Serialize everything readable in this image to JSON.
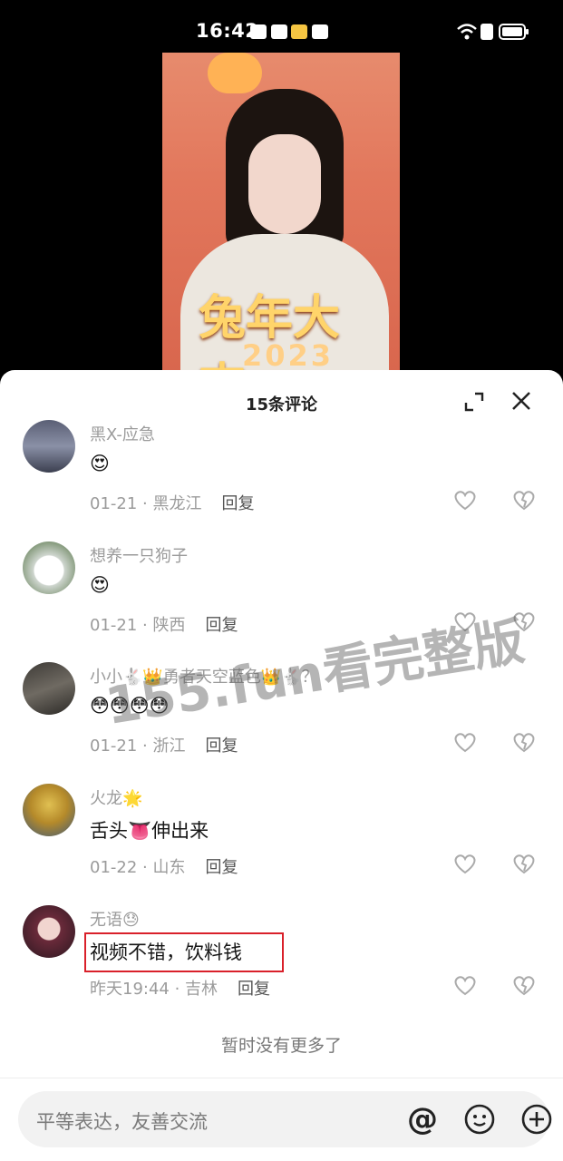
{
  "status_bar": {
    "time": "16:42"
  },
  "video": {
    "headline": "兔年大吉",
    "year": "2023"
  },
  "sheet": {
    "title": "15条评论"
  },
  "comments": [
    {
      "user": "黑X-应急",
      "text": "😍",
      "date": "01-21",
      "location": "黑龙江",
      "reply": "回复"
    },
    {
      "user": "想养一只狗子",
      "text": "😍",
      "date": "01-21",
      "location": "陕西",
      "reply": "回复"
    },
    {
      "user": "小小🐇👑勇者天空蓝色👑🐇？",
      "text": "😳😳😳😳",
      "date": "01-21",
      "location": "浙江",
      "reply": "回复"
    },
    {
      "user": "火龙🌟",
      "text": "舌头👅伸出来",
      "date": "01-22",
      "location": "山东",
      "reply": "回复"
    },
    {
      "user": "无语😓",
      "text": "视频不错，饮料钱",
      "date": "昨天19:44",
      "location": "吉林",
      "reply": "回复"
    }
  ],
  "footer": {
    "no_more": "暂时没有更多了",
    "input_placeholder": "平等表达，友善交流",
    "at_symbol": "@"
  },
  "watermark": "155.fun看完整版",
  "colors": {
    "highlight": "#d9202a",
    "meta_gray": "#9b9b9b"
  }
}
